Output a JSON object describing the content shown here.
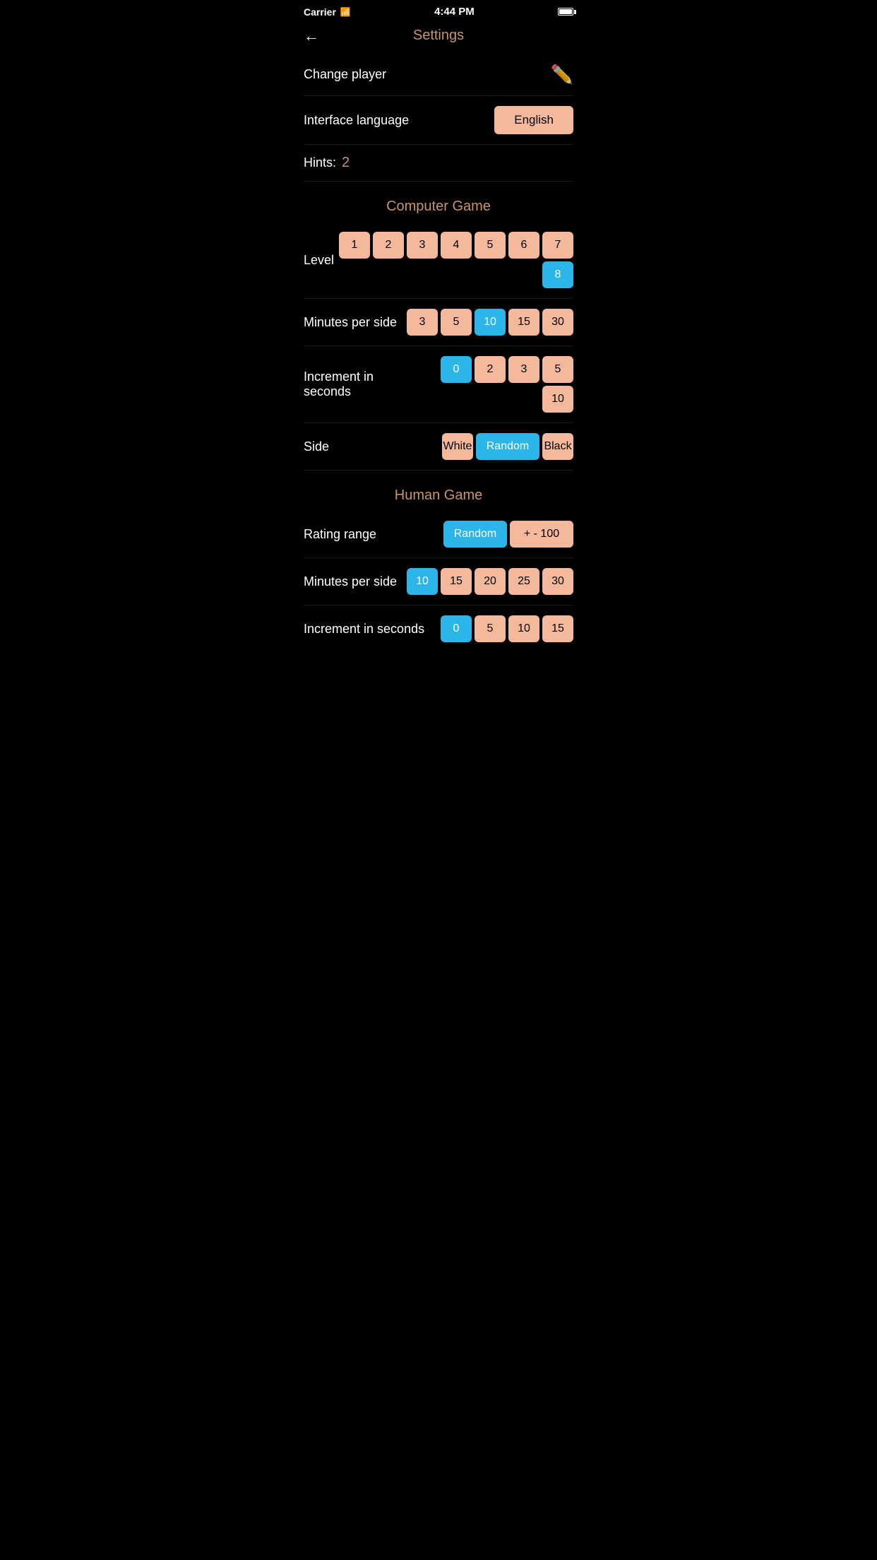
{
  "statusBar": {
    "carrier": "Carrier",
    "time": "4:44 PM"
  },
  "nav": {
    "backLabel": "←",
    "title": "Settings"
  },
  "changePlayer": {
    "label": "Change player"
  },
  "interfaceLanguage": {
    "label": "Interface language",
    "value": "English"
  },
  "hints": {
    "label": "Hints:",
    "value": "2"
  },
  "computerGame": {
    "sectionTitle": "Computer Game",
    "level": {
      "label": "Level",
      "options": [
        "1",
        "2",
        "3",
        "4",
        "5",
        "6",
        "7",
        "8"
      ],
      "selected": "8"
    },
    "minutesPerSide": {
      "label": "Minutes per side",
      "options": [
        "3",
        "5",
        "10",
        "15",
        "30"
      ],
      "selected": "10"
    },
    "incrementInSeconds": {
      "label": "Increment in seconds",
      "options": [
        "0",
        "2",
        "3",
        "5",
        "10"
      ],
      "selected": "0"
    },
    "side": {
      "label": "Side",
      "options": [
        "White",
        "Random",
        "Black"
      ],
      "selected": "Random"
    }
  },
  "humanGame": {
    "sectionTitle": "Human Game",
    "ratingRange": {
      "label": "Rating range",
      "options": [
        "Random",
        "+ - 100"
      ],
      "selected": "Random"
    },
    "minutesPerSide": {
      "label": "Minutes per side",
      "options": [
        "10",
        "15",
        "20",
        "25",
        "30"
      ],
      "selected": "10"
    },
    "incrementInSeconds": {
      "label": "Increment in seconds",
      "options": [
        "0",
        "5",
        "10",
        "15"
      ],
      "selected": "0"
    }
  }
}
